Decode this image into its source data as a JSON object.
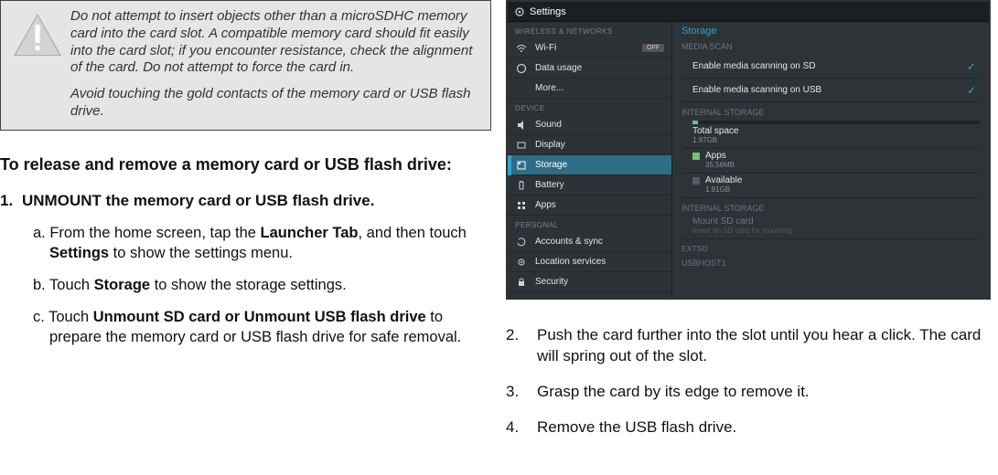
{
  "warning": {
    "para1": "Do not attempt to insert objects other than a microSDHC memory card into the card slot. A compatible memory card should fit easily into the card slot; if you encounter resistance, check the alignment of the card. Do not attempt to force the card in.",
    "para2": "Avoid touching the gold contacts of the memory card or USB flash drive."
  },
  "leftHeading": "To release and remove a memory card or USB flash drive:",
  "step1": {
    "number": "1.",
    "title": "UNMOUNT the memory card or USB flash drive.",
    "a": {
      "label": "a.",
      "pre": " From the home screen, tap the ",
      "bold1": "Launcher Tab",
      "mid": ", and then touch ",
      "bold2": "Settings",
      "post": " to show the settings menu."
    },
    "b": {
      "label": "b.",
      "pre": " Touch ",
      "bold1": "Storage",
      "post": " to show the storage settings."
    },
    "c": {
      "label": "c.",
      "pre": " Touch ",
      "bold1": "Unmount SD card or Unmount USB flash drive",
      "post": " to prepare the memory card or USB flash drive for safe removal."
    }
  },
  "rightSteps": {
    "s2": {
      "n": "2.",
      "t": "Push the card further into the slot until you hear a click. The card will spring out of the slot."
    },
    "s3": {
      "n": "3.",
      "t": "Grasp the card by its edge to remove it."
    },
    "s4": {
      "n": "4.",
      "t": "Remove the USB flash drive."
    }
  },
  "shot": {
    "title": "Settings",
    "left": {
      "sec1": "WIRELESS & NETWORKS",
      "wifi": "Wi-Fi",
      "wifiState": "OFF",
      "data": "Data usage",
      "more": "More...",
      "sec2": "DEVICE",
      "sound": "Sound",
      "display": "Display",
      "storage": "Storage",
      "battery": "Battery",
      "apps": "Apps",
      "sec3": "PERSONAL",
      "accounts": "Accounts & sync",
      "location": "Location services",
      "security": "Security"
    },
    "right": {
      "title": "Storage",
      "mediaScan": "MEDIA SCAN",
      "scanSD": "Enable media scanning on SD",
      "scanUSB": "Enable media scanning on USB",
      "internal": "INTERNAL STORAGE",
      "total": {
        "k": "Total space",
        "v": "1.97GB"
      },
      "apps": {
        "k": "Apps",
        "v": "35.56MB"
      },
      "avail": {
        "k": "Available",
        "v": "1.91GB"
      },
      "internal2": "INTERNAL STORAGE",
      "mount": {
        "k": "Mount SD card",
        "v": "Insert an SD card for mounting"
      },
      "extsd": "EXTSD",
      "usbhost": "USBHOST1"
    }
  }
}
